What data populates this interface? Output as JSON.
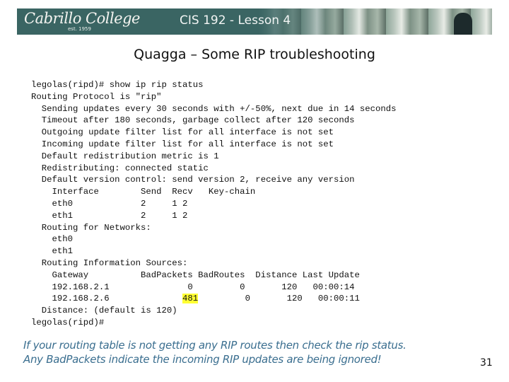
{
  "header": {
    "logo_text": "Cabrillo College",
    "logo_est": "est. 1959",
    "course_title": "CIS 192 - Lesson 4"
  },
  "slide": {
    "title": "Quagga – Some RIP troubleshooting",
    "page_number": "31"
  },
  "terminal": {
    "lines": [
      "legolas(ripd)# show ip rip status",
      "Routing Protocol is \"rip\"",
      "  Sending updates every 30 seconds with +/-50%, next due in 14 seconds",
      "  Timeout after 180 seconds, garbage collect after 120 seconds",
      "  Outgoing update filter list for all interface is not set",
      "  Incoming update filter list for all interface is not set",
      "  Default redistribution metric is 1",
      "  Redistributing: connected static",
      "  Default version control: send version 2, receive any version",
      "    Interface        Send  Recv   Key-chain",
      "    eth0             2     1 2",
      "    eth1             2     1 2",
      "  Routing for Networks:",
      "    eth0",
      "    eth1",
      "  Routing Information Sources:",
      "    Gateway          BadPackets BadRoutes  Distance Last Update",
      "    192.168.2.1               0         0       120   00:00:14",
      "    192.168.2.6 ",
      "  Distance: (default is 120)",
      "legolas(ripd)#"
    ],
    "row2_badpackets": "481",
    "row2_rest": "         0       120   00:00:11",
    "row2_pad": "             "
  },
  "note": {
    "line1": "If your routing table is not getting any RIP routes then check the rip status.",
    "line2": "Any BadPackets indicate the incoming RIP updates are being ignored!"
  },
  "colors": {
    "banner": "#3a6563",
    "note_text": "#3a6e8f",
    "highlight": "#ffff33"
  }
}
